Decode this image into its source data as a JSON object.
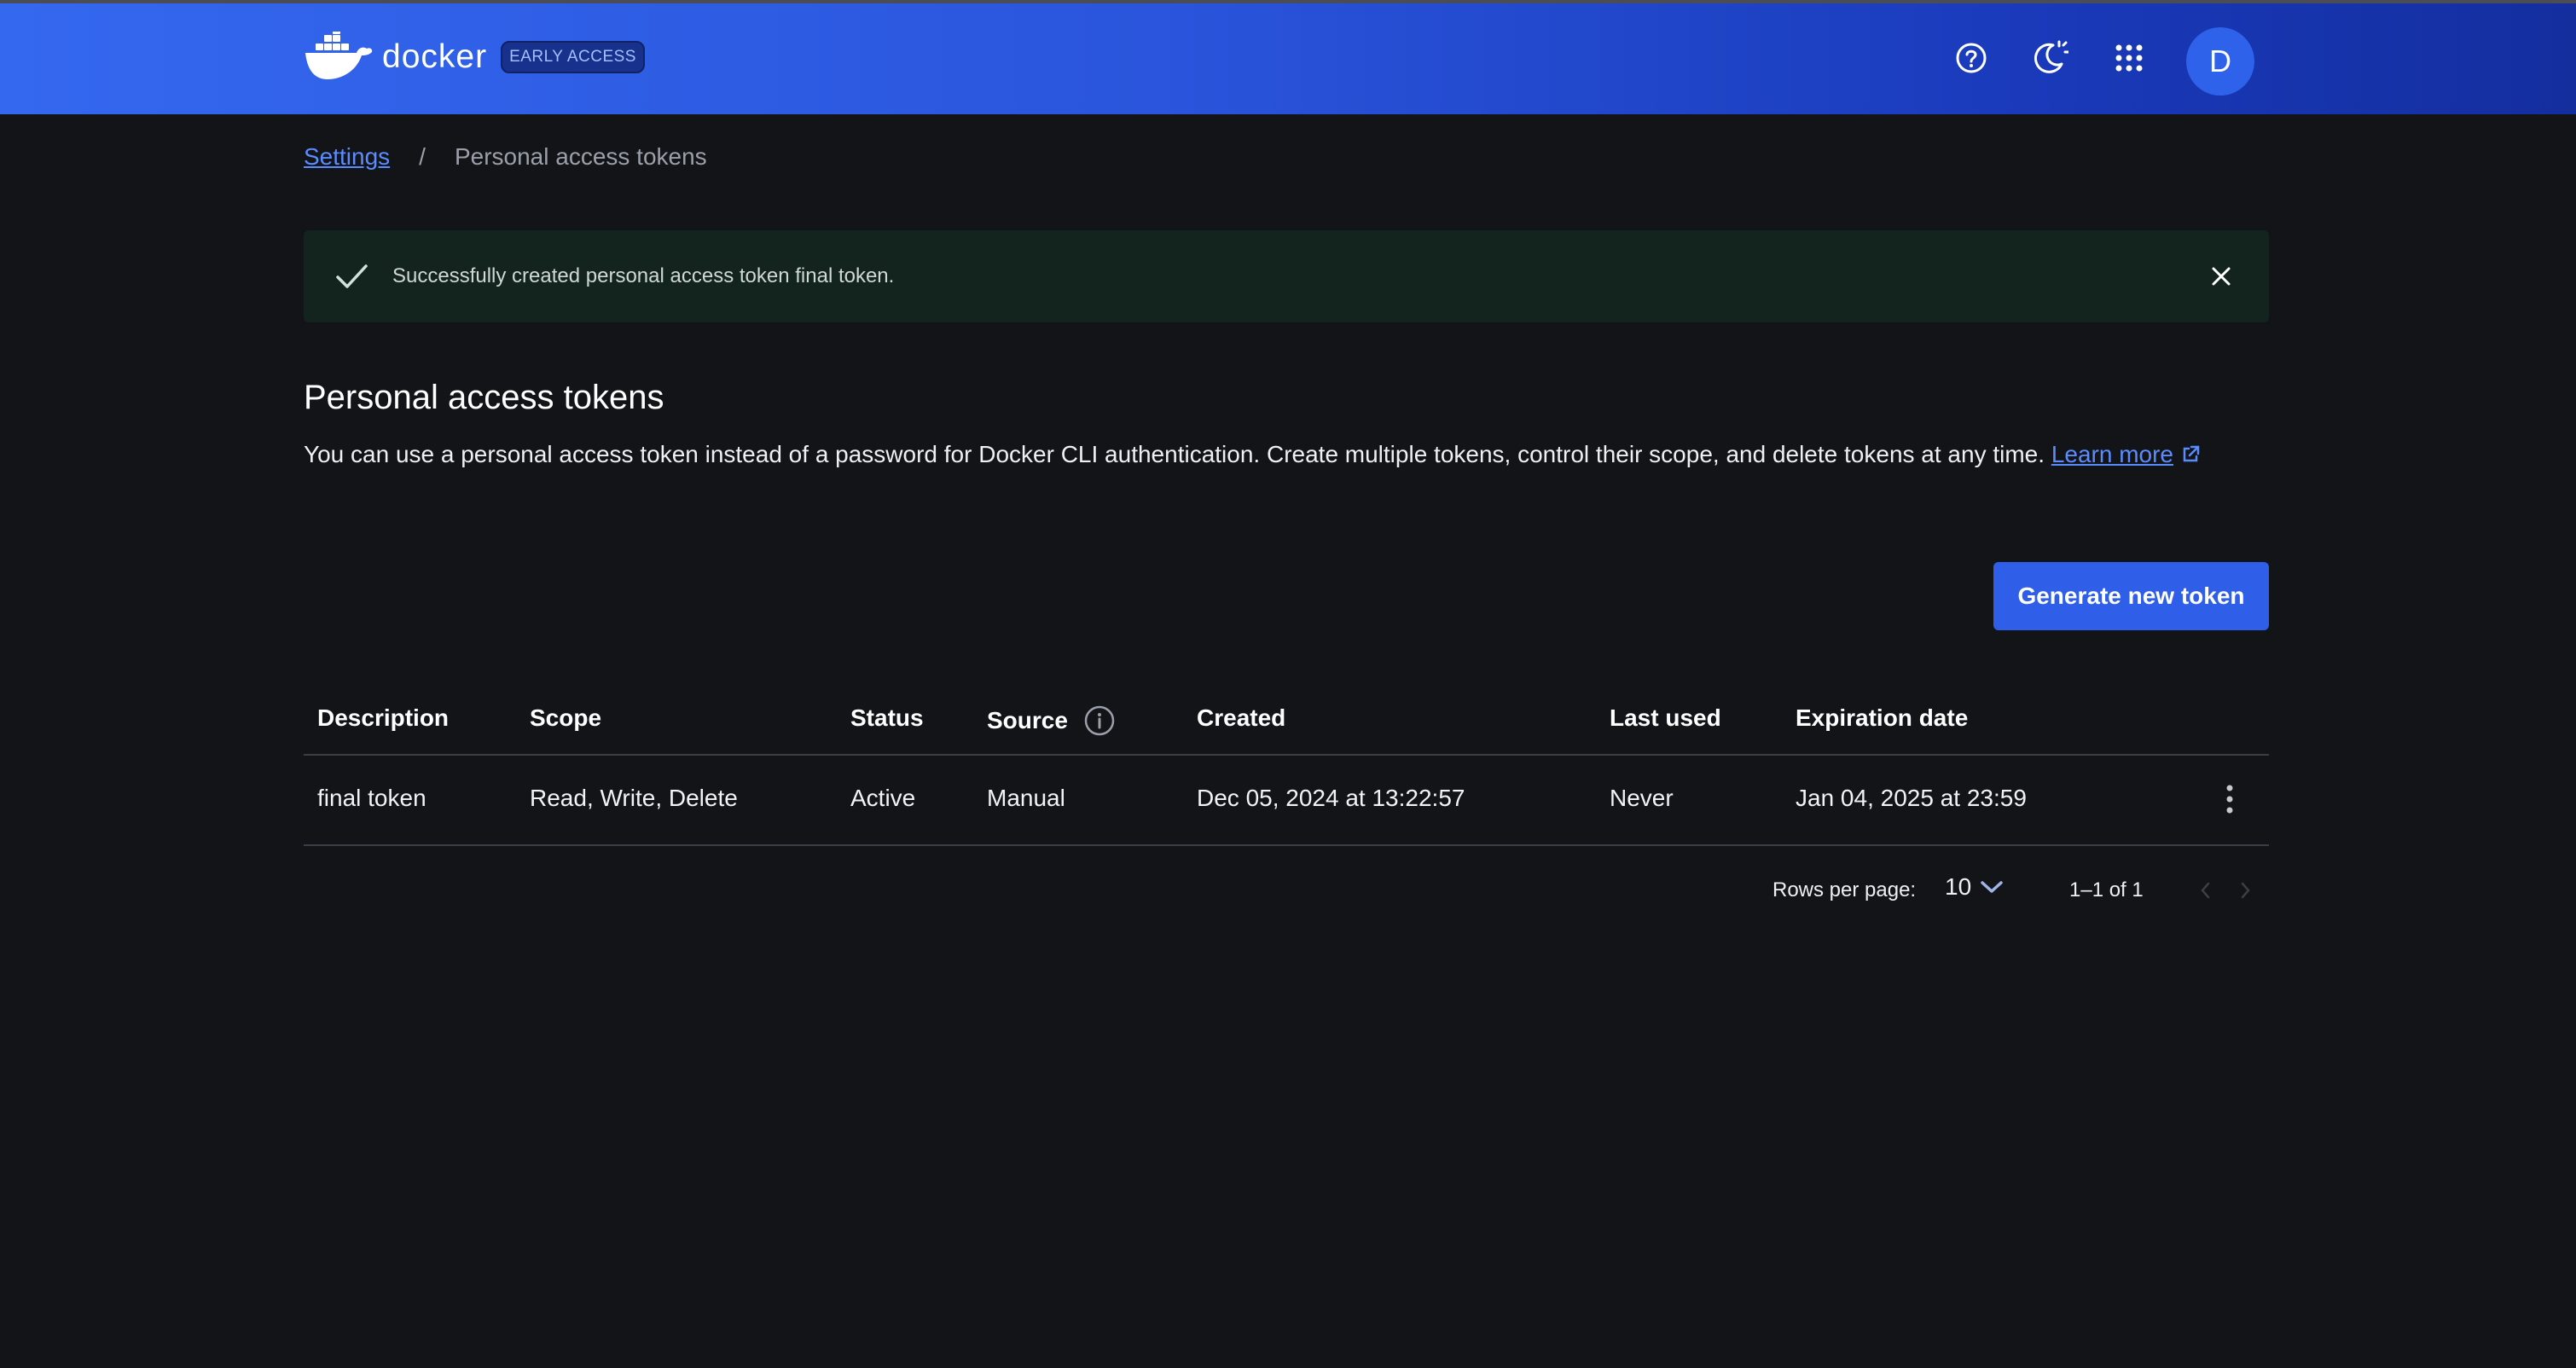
{
  "header": {
    "brand": "docker",
    "badge": "EARLY ACCESS",
    "avatar_initial": "D",
    "icons": [
      "help-circle-icon",
      "theme-toggle-icon",
      "apps-grid-icon"
    ]
  },
  "breadcrumb": {
    "parent": "Settings",
    "separator": "/",
    "current": "Personal access tokens"
  },
  "alert": {
    "message": "Successfully created personal access token final token."
  },
  "page": {
    "title": "Personal access tokens",
    "description": "You can use a personal access token instead of a password for Docker CLI authentication. Create multiple tokens, control their scope, and delete tokens at any time.",
    "learn_more": "Learn more",
    "generate_button": "Generate new token"
  },
  "table": {
    "columns": [
      "Description",
      "Scope",
      "Status",
      "Source",
      "Created",
      "Last used",
      "Expiration date"
    ],
    "rows": [
      {
        "description": "final token",
        "scope": "Read, Write, Delete",
        "status": "Active",
        "source": "Manual",
        "created": "Dec 05, 2024 at 13:22:57",
        "last_used": "Never",
        "expiration": "Jan 04, 2025 at 23:59"
      }
    ]
  },
  "pagination": {
    "rows_per_page_label": "Rows per page:",
    "rows_per_page": "10",
    "range": "1–1 of 1"
  },
  "colors": {
    "header_start": "#3468ef",
    "header_end": "#142e9e",
    "background": "#121418",
    "link": "#5b8cff",
    "primary_button": "#2f5fe8",
    "alert_bg": "#13241f"
  }
}
